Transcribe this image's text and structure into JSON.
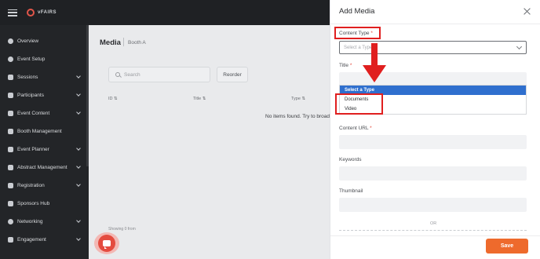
{
  "app": {
    "logo_text": "vFAIRS"
  },
  "sidebar": {
    "items": [
      {
        "label": "Overview",
        "icon": "overview-icon",
        "has_chevron": false
      },
      {
        "label": "Event Setup",
        "icon": "gear-icon",
        "has_chevron": false
      },
      {
        "label": "Sessions",
        "icon": "grid-icon",
        "has_chevron": true
      },
      {
        "label": "Participants",
        "icon": "users-icon",
        "has_chevron": true
      },
      {
        "label": "Event Content",
        "icon": "document-icon",
        "has_chevron": true
      },
      {
        "label": "Booth Management",
        "icon": "booth-icon",
        "has_chevron": false
      },
      {
        "label": "Event Planner",
        "icon": "calendar-icon",
        "has_chevron": true
      },
      {
        "label": "Abstract Management",
        "icon": "abstract-icon",
        "has_chevron": true
      },
      {
        "label": "Registration",
        "icon": "user-add-icon",
        "has_chevron": true
      },
      {
        "label": "Sponsors Hub",
        "icon": "sponsors-icon",
        "has_chevron": false
      },
      {
        "label": "Networking",
        "icon": "share-icon",
        "has_chevron": true
      },
      {
        "label": "Engagement",
        "icon": "engagement-icon",
        "has_chevron": true
      }
    ]
  },
  "main": {
    "title": "Media",
    "subtitle": "Booth A",
    "search_placeholder": "Search",
    "reorder_label": "Reorder",
    "columns": [
      "ID ⇅",
      "Title ⇅",
      "Type ⇅"
    ],
    "empty_message": "No items found. Try to broad",
    "showing_text": "Showing 0 from"
  },
  "modal": {
    "title": "Add Media",
    "content_type_label": "Content Type",
    "content_type_placeholder": "Select a Type",
    "title_label": "Title",
    "content_url_label": "Content URL",
    "keywords_label": "Keywords",
    "thumbnail_label": "Thumbnail",
    "or_text": "OR",
    "required_mark": "*",
    "dropdown_options": [
      "Select a Type",
      "Documents",
      "Video"
    ],
    "save_label": "Save"
  },
  "colors": {
    "accent": "#ee6a2c",
    "highlight": "#e01f1f",
    "selected_option": "#2f6fce",
    "sidebar_bg": "#232528"
  }
}
